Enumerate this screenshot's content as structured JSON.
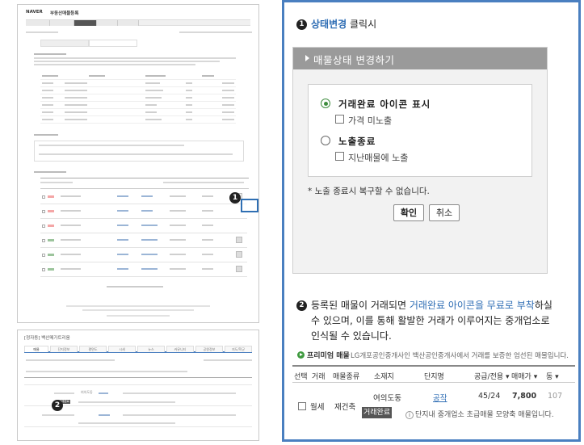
{
  "left_top": {
    "logo": "NAVER",
    "title": "부동산매물등록",
    "step_number": "1"
  },
  "left_bottom": {
    "title": "[정자동] 백산메가트리움",
    "tabs": [
      "매물",
      "단지정보",
      "평면도",
      "시세",
      "뉴스",
      "커뮤니티",
      "공원정보",
      "지도/학군"
    ],
    "step_number": "2",
    "complex_name": "여의도동",
    "done_tag": "거래완료"
  },
  "panel": {
    "step1": {
      "number": "1",
      "highlight": "상태변경",
      "rest": " 클릭시"
    },
    "dialog": {
      "title": "매물상태 변경하기",
      "option1_label": "거래완료 아이콘 표시",
      "option1_sub": "가격 미노출",
      "option2_label": "노출종료",
      "option2_sub": "지난매물에 노출",
      "note": "* 노출 종료시 복구할 수 없습니다.",
      "confirm": "확인",
      "cancel": "취소"
    },
    "step2": {
      "number": "2",
      "line1_a": "등록된 매물이 거래되면 ",
      "line1_hl": "거래완료 아이콘을 무료로 부착",
      "line1_b": "하실",
      "line2": "수 있으며, 이를 통해 활발한 거래가 이루어지는 중개업소로",
      "line3": "인식될 수 있습니다."
    },
    "premium": {
      "title": "프리미엄 매물",
      "desc": "LG개포공인중개사인 백산공인중개사에서 거래를 보증한 엄선된 매물입니다.",
      "headers": [
        "선택",
        "거래",
        "매물종류",
        "소재지",
        "단지명",
        "공급/전용 ▾",
        "매매가 ▾",
        "동 ▾"
      ],
      "row": {
        "deal": "월세",
        "type": "재건축",
        "location": "여의도동",
        "complex": "공작",
        "area": "45/24",
        "price": "7,800",
        "dong": "107",
        "done_tag": "거래완료",
        "tip": "단지내 중개업소 초급매물 모양축 매물입니다."
      }
    }
  }
}
